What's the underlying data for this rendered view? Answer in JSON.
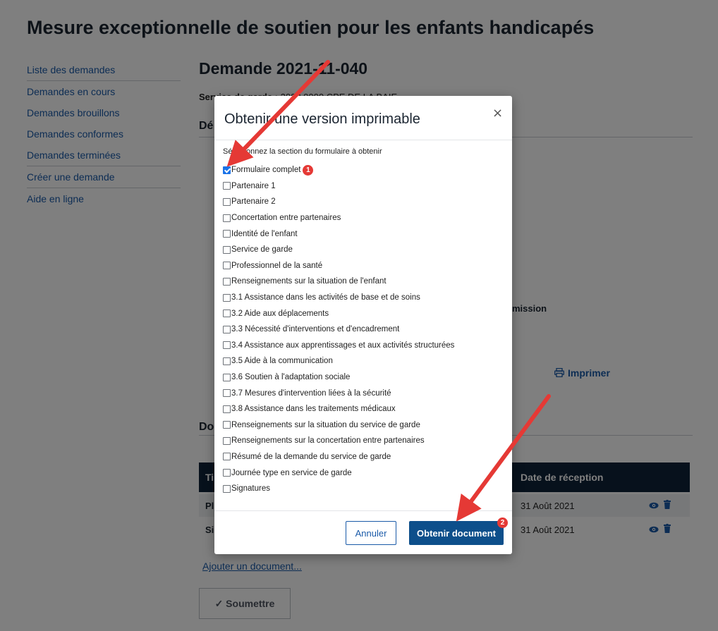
{
  "page": {
    "title": "Mesure exceptionnelle de soutien pour les enfants handicapés"
  },
  "sidebar": {
    "items": [
      {
        "label": "Liste des demandes"
      },
      {
        "label": "Demandes en cours"
      },
      {
        "label": "Demandes brouillons"
      },
      {
        "label": "Demandes conformes"
      },
      {
        "label": "Demandes terminées"
      },
      {
        "label": "Créer une demande"
      },
      {
        "label": "Aide en ligne"
      }
    ]
  },
  "request": {
    "title": "Demande 2021-11-040",
    "service_label": "Service de garde :",
    "service_value": "2002 0000 CPE DE LA BAIE",
    "section_fragment": "Dé",
    "admission_fragment": "mission",
    "print_label": "Imprimer",
    "docs_fragment": "Do"
  },
  "documents_table": {
    "header_fragment": "Ti",
    "date_header": "Date de réception",
    "rows": [
      {
        "name_fragment": "Pl",
        "date": "31 Août 2021"
      },
      {
        "name_fragment": "Si",
        "date": "31 Août 2021"
      }
    ],
    "add_link": "Ajouter un document..."
  },
  "submit": {
    "label": "✓ Soumettre"
  },
  "modal": {
    "title": "Obtenir une version imprimable",
    "close_glyph": "×",
    "select_label": "Sélectionnez la section du formulaire à obtenir",
    "options": [
      {
        "label": "Formulaire complet",
        "checked": true
      },
      {
        "label": "Partenaire 1",
        "checked": false
      },
      {
        "label": "Partenaire 2",
        "checked": false
      },
      {
        "label": "Concertation entre partenaires",
        "checked": false
      },
      {
        "label": "Identité de l'enfant",
        "checked": false
      },
      {
        "label": "Service de garde",
        "checked": false
      },
      {
        "label": "Professionnel de la santé",
        "checked": false
      },
      {
        "label": "Renseignements sur la situation de l'enfant",
        "checked": false
      },
      {
        "label": "3.1 Assistance dans les activités de base et de soins",
        "checked": false
      },
      {
        "label": "3.2 Aide aux déplacements",
        "checked": false
      },
      {
        "label": "3.3 Nécessité d'interventions et d'encadrement",
        "checked": false
      },
      {
        "label": "3.4 Assistance aux apprentissages et aux activités structurées",
        "checked": false
      },
      {
        "label": "3.5 Aide à la communication",
        "checked": false
      },
      {
        "label": "3.6 Soutien à l'adaptation sociale",
        "checked": false
      },
      {
        "label": "3.7 Mesures d'intervention liées à la sécurité",
        "checked": false
      },
      {
        "label": "3.8 Assistance dans les traitements médicaux",
        "checked": false
      },
      {
        "label": "Renseignements sur la situation du service de garde",
        "checked": false
      },
      {
        "label": "Renseignements sur la concertation entre partenaires",
        "checked": false
      },
      {
        "label": "Résumé de la demande du service de garde",
        "checked": false
      },
      {
        "label": "Journée type en service de garde",
        "checked": false
      },
      {
        "label": "Signatures",
        "checked": false
      }
    ],
    "cancel_label": "Annuler",
    "get_label": "Obtenir document",
    "badge_1": "1",
    "badge_2": "2"
  },
  "colors": {
    "link": "#1a5aa8",
    "primary_button": "#0d4f8b",
    "table_header": "#0e2238",
    "annotation_red": "#e53935"
  }
}
